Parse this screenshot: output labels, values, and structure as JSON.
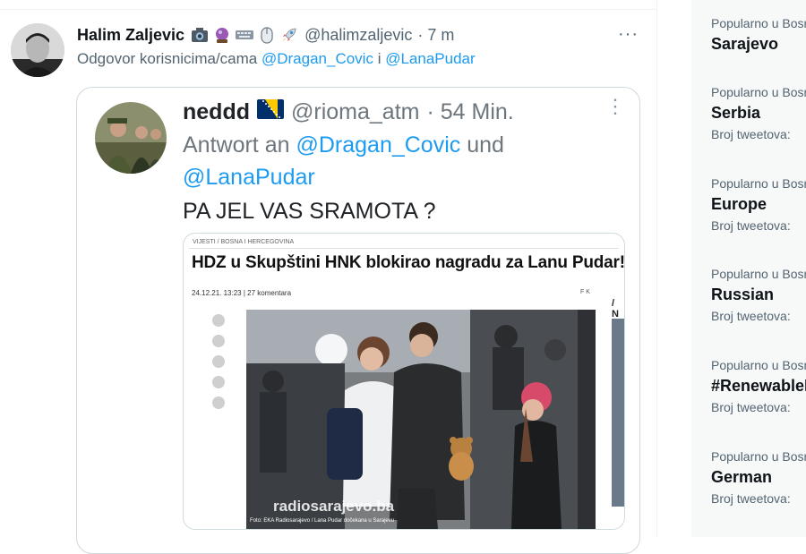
{
  "tweet": {
    "author_name": "Halim Zaljevic",
    "emojis": [
      "camera-icon",
      "crystal-ball-icon",
      "keyboard-icon",
      "mouse-icon",
      "rocket-icon"
    ],
    "handle": "@halimzaljevic",
    "time": "· 7 m",
    "more_label": "···",
    "reply_prefix": "Odgovor korisnicima/cama",
    "reply_mention_1": "@Dragan_Covic",
    "reply_join": "i",
    "reply_mention_2": "@LanaPudar"
  },
  "quote": {
    "author_name": "neddd",
    "flag": "bosnia-flag-icon",
    "handle": "@rioma_atm",
    "time": "· 54 Min.",
    "more_label": "⋮",
    "reply_prefix": "Antwort an",
    "reply_mention_1": "@Dragan_Covic",
    "reply_join": "und",
    "reply_mention_2": "@LanaPudar",
    "text": "PA JEL VAS SRAMOTA ?"
  },
  "article": {
    "breadcrumb": "VIJESTI / BOSNA I HERCEGOVINA",
    "title": "HDZ u Skupštini HNK blokirao nagradu za Lanu Pudar!",
    "meta": "24.12.21. 13:23  |  27 komentara",
    "meta_right": "F K",
    "side_text": "/ N",
    "watermark": "radiosarajevo.ba",
    "credit": "Foto: EKA Radiosarajevo / Lana Pudar dočekana u Sarajevu"
  },
  "trends": [
    {
      "category": "Popularno u Bosni i Hercegovini",
      "name": "Sarajevo",
      "count": ""
    },
    {
      "category": "Popularno u Bosni i Hercegovini",
      "name": "Serbia",
      "count": "Broj tweetova:"
    },
    {
      "category": "Popularno u Bosni i Hercegovini",
      "name": "Europe",
      "count": "Broj tweetova:"
    },
    {
      "category": "Popularno u Bosni i Hercegovini",
      "name": "Russian",
      "count": "Broj tweetova:"
    },
    {
      "category": "Popularno u Bosni i Hercegovini",
      "name": "#RenewableEnergy",
      "count": "Broj tweetova:"
    },
    {
      "category": "Popularno u Bosni i Hercegovini",
      "name": "German",
      "count": "Broj tweetova:"
    }
  ],
  "colors": {
    "accent": "#1d9bf0",
    "secondary_text": "#536471",
    "sidebar_bg": "#f7f9f9"
  }
}
